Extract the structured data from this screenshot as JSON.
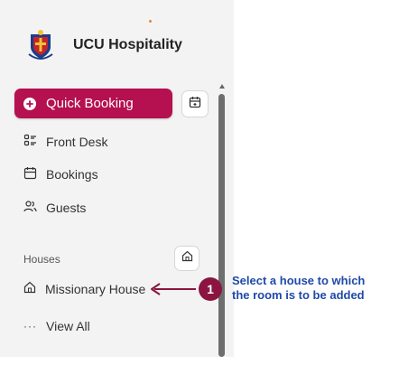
{
  "brand": {
    "name": "UCU Hospitality"
  },
  "primary_action": {
    "label": "Quick Booking",
    "color": "#b5104f"
  },
  "nav": [
    {
      "label": "Front Desk",
      "icon": "front-desk-icon"
    },
    {
      "label": "Bookings",
      "icon": "calendar-icon"
    },
    {
      "label": "Guests",
      "icon": "guests-icon"
    }
  ],
  "houses": {
    "section_label": "Houses",
    "items": [
      {
        "label": "Missionary House",
        "icon": "house-icon"
      }
    ],
    "view_all_label": "View All"
  },
  "callout": {
    "number": "1",
    "text_line1": "Select a house to which",
    "text_line2": "the room is to be added",
    "badge_color": "#8b1540",
    "text_color": "#1f4aa8"
  }
}
